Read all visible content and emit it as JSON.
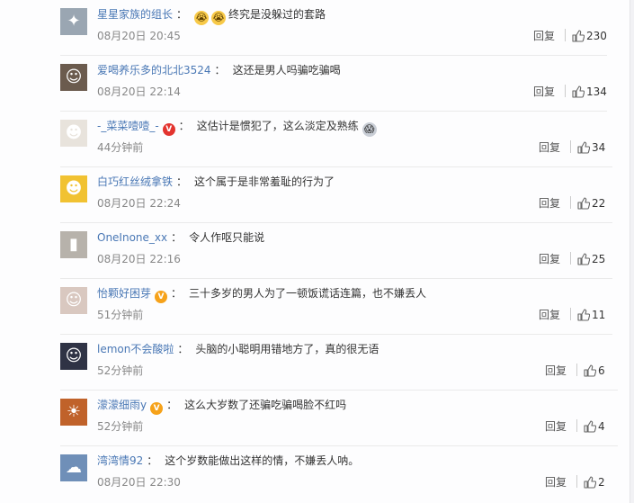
{
  "comments": [
    {
      "user": "星星家族的组长",
      "badge": "",
      "emojis": [
        "😭",
        "😭"
      ],
      "text": "终究是没躲过的套路",
      "time": "08月20日 20:45",
      "reply": "回复",
      "likes": "230",
      "avatar_bg": "#9aa6b2",
      "avatar_icon": "user-photo-icon",
      "emoji_icon": "laugh-cry-emoji-icon",
      "avatar_char": "✦"
    },
    {
      "user": "爱喝养乐多的北北3524",
      "badge": "",
      "emojis": [],
      "text": "这还是男人吗骗吃骗喝",
      "time": "08月20日 22:14",
      "reply": "回复",
      "likes": "134",
      "avatar_bg": "#6b5b4e",
      "avatar_icon": "user-photo-icon",
      "avatar_char": "☺"
    },
    {
      "user": "-_菜菜噎噎_-",
      "badge": "V",
      "badge_color": "red",
      "emojis": [],
      "text": "这估计是惯犯了，这么淡定及熟练",
      "trail_emoji": "😱",
      "time": "44分钟前",
      "reply": "回复",
      "likes": "34",
      "avatar_bg": "#e8e3dc",
      "avatar_icon": "cartoon-avatar-icon",
      "badge_icon": "v-verified-badge-icon",
      "trail_icon": "shocked-emoji-icon",
      "avatar_char": "☻"
    },
    {
      "user": "白巧红丝绒拿铁",
      "badge": "",
      "emojis": [],
      "text": "这个属于是非常羞耻的行为了",
      "time": "08月20日 22:24",
      "reply": "回复",
      "likes": "22",
      "avatar_bg": "#f1c232",
      "avatar_icon": "cartoon-avatar-icon",
      "avatar_char": "☻"
    },
    {
      "user": "OneInone_xx",
      "badge": "",
      "emojis": [],
      "text": "令人作呕只能说",
      "time": "08月20日 22:16",
      "reply": "回复",
      "likes": "25",
      "avatar_bg": "#b7b2ab",
      "avatar_icon": "user-photo-icon",
      "avatar_char": "▮"
    },
    {
      "user": "怡颗好困芽",
      "badge": "V",
      "badge_color": "orange",
      "emojis": [],
      "text": "三十多岁的男人为了一顿饭谎话连篇，也不嫌丢人",
      "time": "51分钟前",
      "reply": "回复",
      "likes": "11",
      "avatar_bg": "#d9c8c0",
      "avatar_icon": "user-photo-icon",
      "badge_icon": "v-verified-badge-icon",
      "avatar_char": "☺"
    },
    {
      "user": "lemon不会酸啦",
      "badge": "",
      "emojis": [],
      "text": "头脑的小聪明用错地方了，真的很无语",
      "time": "52分钟前",
      "reply": "回复",
      "likes": "6",
      "avatar_bg": "#2f3345",
      "avatar_icon": "user-photo-icon",
      "avatar_char": "☺"
    },
    {
      "user": "濛濛细雨y",
      "badge": "V",
      "badge_color": "orange",
      "emojis": [],
      "text": "这么大岁数了还骗吃骗喝脸不红吗",
      "time": "52分钟前",
      "reply": "回复",
      "likes": "4",
      "avatar_bg": "#c0622a",
      "avatar_icon": "sunset-photo-icon",
      "badge_icon": "v-verified-badge-icon",
      "avatar_char": "☀"
    },
    {
      "user": "湾湾情92",
      "badge": "",
      "emojis": [],
      "text": "这个岁数能做出这样的情，不嫌丢人呐。",
      "time": "08月20日 22:30",
      "reply": "回复",
      "likes": "2",
      "avatar_bg": "#6f8fb8",
      "avatar_icon": "user-photo-icon",
      "avatar_char": "☁"
    }
  ],
  "colors": {
    "username": "#4a78b5",
    "text": "#333333",
    "meta": "#888888",
    "badge_orange": "#f6a21a",
    "badge_red": "#e3342f"
  },
  "icons": {
    "like": "thumbs-up-icon"
  }
}
